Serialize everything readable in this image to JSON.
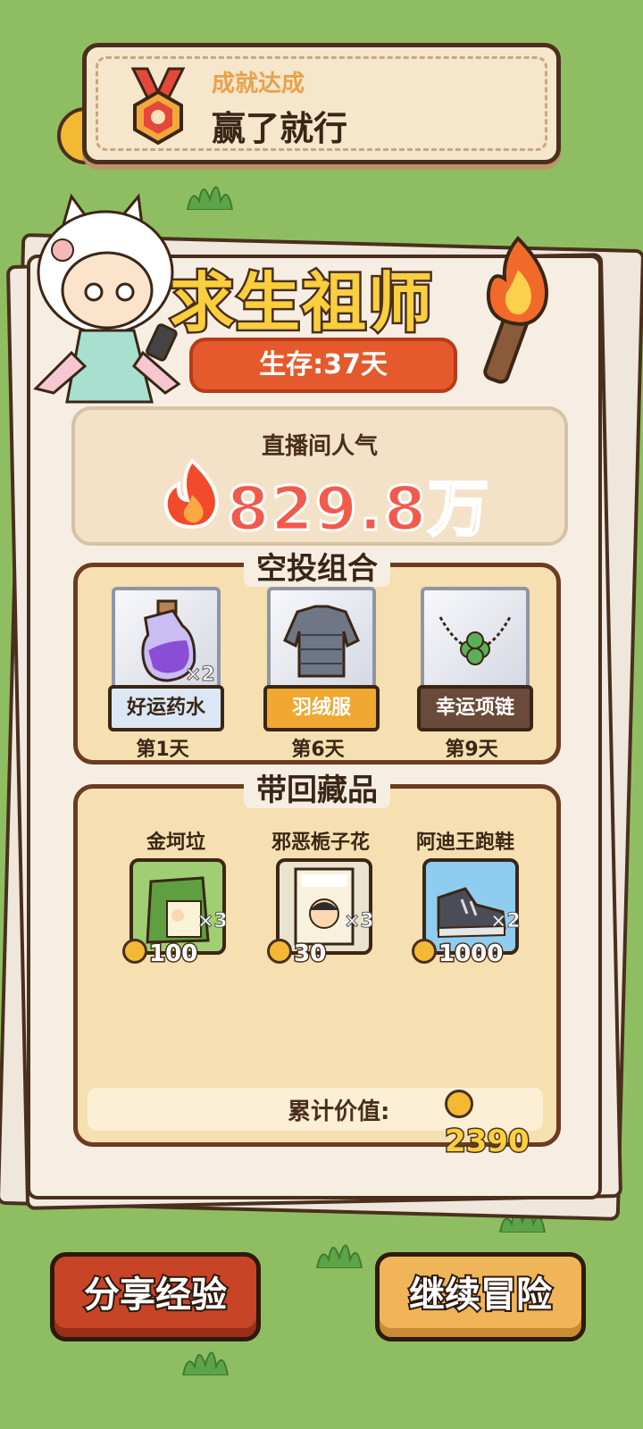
{
  "achievement": {
    "kicker": "成就达成",
    "title": "赢了就行"
  },
  "result": {
    "title": "求生祖师",
    "survival": "生存:37天"
  },
  "popularity": {
    "label": "直播间人气",
    "value": "829.8万"
  },
  "airdrop": {
    "title": "空投组合",
    "items": [
      {
        "name": "好运药水",
        "qty": "×2",
        "day": "第1天",
        "label_color": "#dbe7f5",
        "label_text_color": "#3a2616",
        "icon": "potion-icon"
      },
      {
        "name": "羽绒服",
        "qty": "",
        "day": "第6天",
        "label_color": "#f0a830",
        "label_text_color": "#ffffff",
        "icon": "down-jacket-icon"
      },
      {
        "name": "幸运项链",
        "qty": "",
        "day": "第9天",
        "label_color": "#6a4a3a",
        "label_text_color": "#ffffff",
        "icon": "necklace-icon"
      }
    ]
  },
  "collection": {
    "title": "带回藏品",
    "items": [
      {
        "name": "金坷垃",
        "qty": "×3",
        "price": "100",
        "icon": "fertilizer-bag-icon",
        "bg": "#9fcf72"
      },
      {
        "name": "邪恶栀子花",
        "qty": "×3",
        "price": "30",
        "icon": "book-icon",
        "bg": "#eae4cf"
      },
      {
        "name": "阿迪王跑鞋",
        "qty": "×2",
        "price": "1000",
        "icon": "sneaker-icon",
        "bg": "#8fcdf0"
      }
    ],
    "total_label": "累计价值:",
    "total_value": "2390"
  },
  "buttons": {
    "share": "分享经验",
    "continue": "继续冒险"
  }
}
